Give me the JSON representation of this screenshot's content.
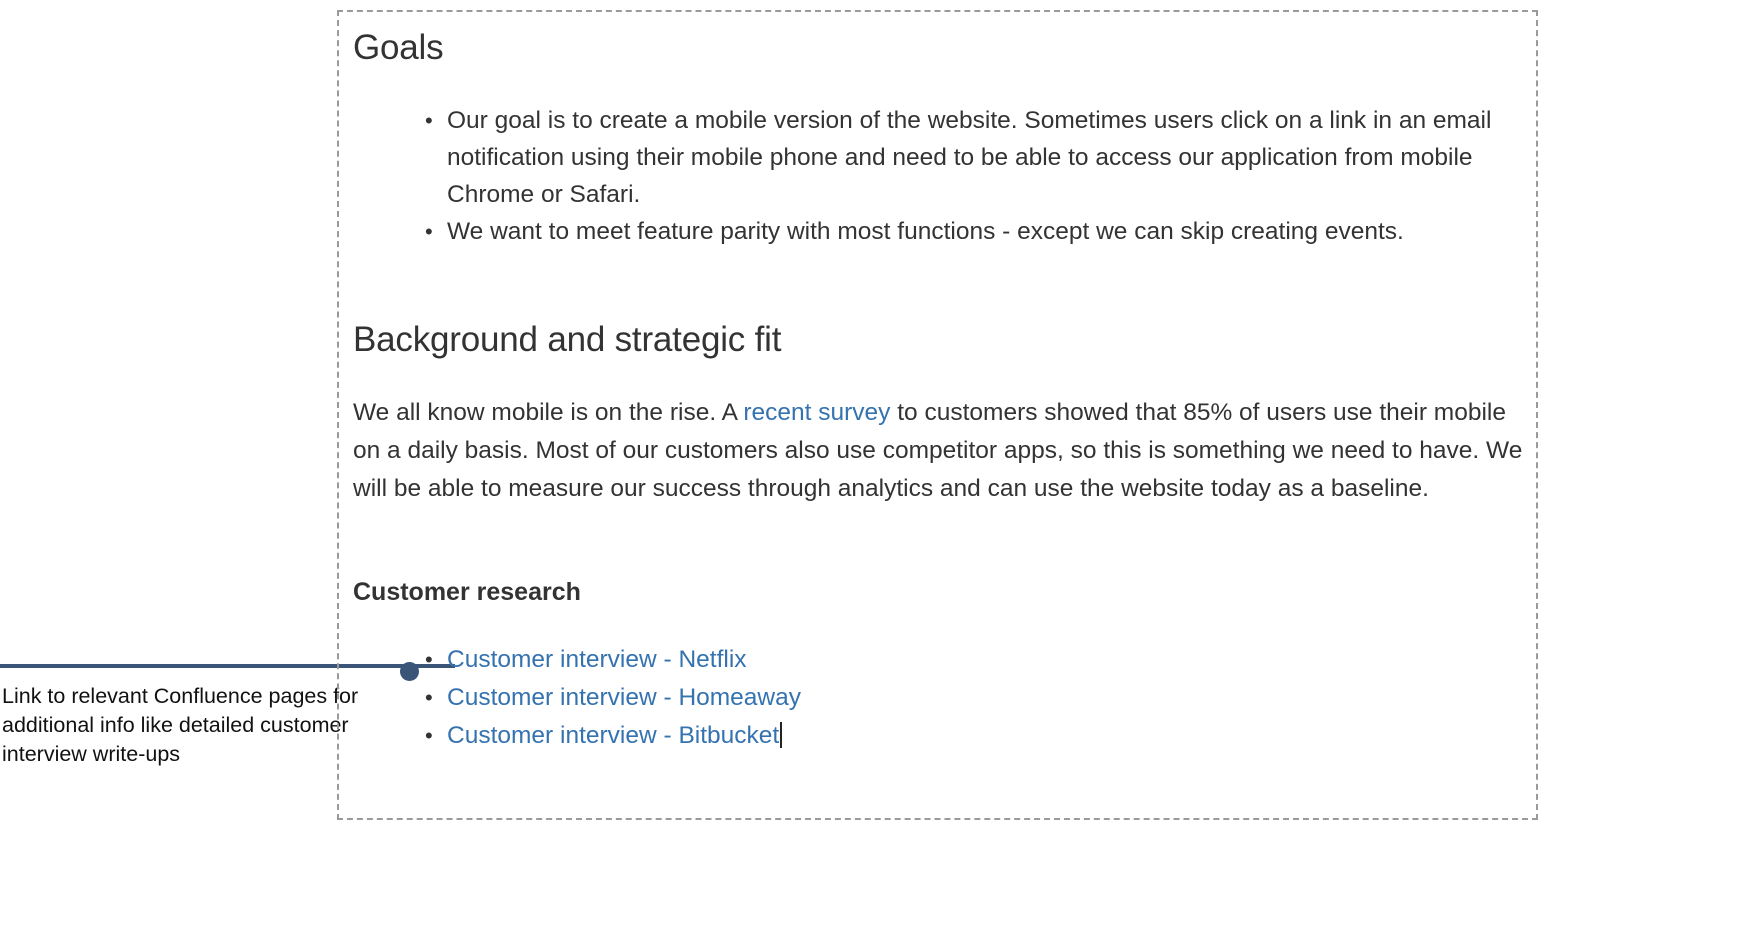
{
  "document": {
    "goals": {
      "heading": "Goals",
      "bullets": [
        "Our goal is to create a mobile version of the website. Sometimes users click on a link in an email notification using their mobile phone and need to be able to access our application from mobile Chrome or Safari.",
        "We want to meet feature parity with most functions - except we can skip creating events."
      ]
    },
    "background": {
      "heading": "Background and strategic fit",
      "paragraph_before_link": "We all know mobile is on the rise. A ",
      "link_text": "recent survey",
      "paragraph_after_link": " to customers showed that 85% of users use their mobile on a daily basis. Most of our customers also use competitor apps, so this is something we need to have. We will be able to measure our success through analytics and can use the website today as a baseline."
    },
    "customer_research": {
      "heading": "Customer research",
      "links": [
        "Customer interview - Netflix",
        "Customer interview - Homeaway",
        "Customer interview - Bitbucket"
      ]
    }
  },
  "annotation": {
    "caption": "Link to relevant Confluence pages for additional info like detailed customer interview write-ups"
  },
  "colors": {
    "link_blue": "#3572b0",
    "annotation_navy": "#3a5578",
    "text_dark": "#333333",
    "frame_dashed": "#9a9a9a"
  }
}
